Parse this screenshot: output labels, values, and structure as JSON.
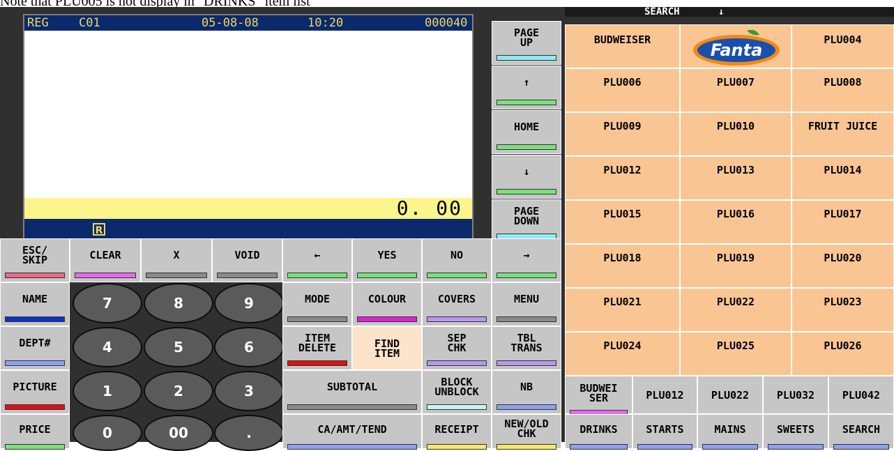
{
  "caption": "Note that PLU005 is not display in \"DRINKS\" item list",
  "display": {
    "mode": "REG",
    "clerk": "C01",
    "date": "05-08-08",
    "time": "10:20",
    "receipt_no": "000040",
    "total": "0. 00",
    "receipt_icon": "R"
  },
  "search_header": {
    "label": "SEARCH",
    "arrow": "↓"
  },
  "nav_keys": {
    "page_up": "PAGE\nUP",
    "up": "↑",
    "home": "HOME",
    "down": "↓",
    "page_down": "PAGE\nDOWN",
    "left": "←",
    "right": "→"
  },
  "function_keys": {
    "esc_skip": "ESC/\nSKIP",
    "clear": "CLEAR",
    "x": "X",
    "void": "VOID",
    "yes": "YES",
    "no": "NO",
    "name": "NAME",
    "dept": "DEPT#",
    "picture": "PICTURE",
    "price": "PRICE",
    "mode": "MODE",
    "colour": "COLOUR",
    "covers": "COVERS",
    "menu": "MENU",
    "item_delete": "ITEM\nDELETE",
    "find_item": "FIND\nITEM",
    "sep_chk": "SEP\nCHK",
    "tbl_trans": "TBL\nTRANS",
    "subtotal": "SUBTOTAL",
    "block_unblock": "BLOCK\nUNBLOCK",
    "nb": "NB",
    "ca_amt_tend": "CA/AMT/TEND",
    "receipt": "RECEIPT",
    "new_old_chk": "NEW/OLD\nCHK"
  },
  "numpad": [
    "7",
    "8",
    "9",
    "4",
    "5",
    "6",
    "1",
    "2",
    "3",
    "0",
    "00",
    "."
  ],
  "plu_keys": [
    "BUDWEISER",
    "PLU004",
    "PLU006",
    "PLU007",
    "PLU008",
    "PLU009",
    "PLU010",
    "FRUIT JUICE",
    "PLU012",
    "PLU013",
    "PLU014",
    "PLU015",
    "PLU016",
    "PLU017",
    "PLU018",
    "PLU019",
    "PLU020",
    "PLU021",
    "PLU022",
    "PLU023",
    "PLU024",
    "PLU025",
    "PLU026"
  ],
  "fanta_logo": "Fanta",
  "quick_keys": [
    "BUDWEI\nSER",
    "PLU012",
    "PLU022",
    "PLU032",
    "PLU042"
  ],
  "category_tabs": [
    "DRINKS",
    "STARTS",
    "MAINS",
    "SWEETS",
    "SEARCH"
  ],
  "colors": {
    "pink": "#e56b8a",
    "magenta": "#e46be8",
    "gray": "#8a8a8a",
    "green": "#7be07b",
    "cyan": "#8fe9f3",
    "blue": "#1030c8",
    "lightblue": "#8ea0f0",
    "red": "#e01010",
    "lightcyan": "#c6f4f6",
    "lavender": "#b798ec",
    "yellow": "#f6e86a"
  }
}
